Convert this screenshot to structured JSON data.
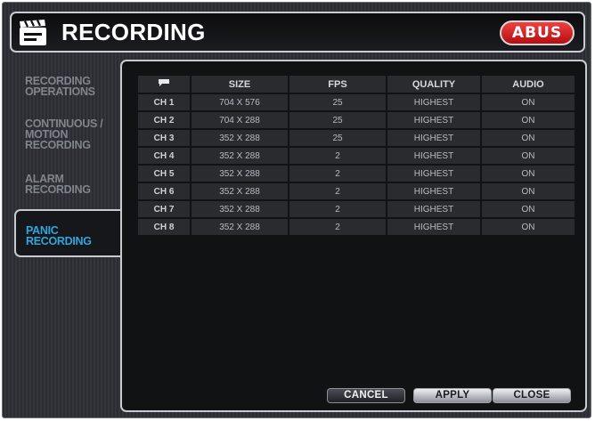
{
  "window": {
    "title": "RECORDING",
    "logo": "ABUS"
  },
  "sidebar": {
    "items": [
      {
        "label": [
          "RECORDING",
          "OPERATIONS"
        ],
        "active": false
      },
      {
        "label": [
          "CONTINUOUS /",
          "MOTION",
          "RECORDING"
        ],
        "active": false
      },
      {
        "label": [
          "ALARM",
          "RECORDING"
        ],
        "active": false
      },
      {
        "label": [
          "PANIC",
          "RECORDING"
        ],
        "active": true
      }
    ]
  },
  "table": {
    "header_icon": "flag-icon",
    "columns": [
      "SIZE",
      "FPS",
      "QUALITY",
      "AUDIO"
    ],
    "rows": [
      {
        "channel": "CH 1",
        "size": "704 X 576",
        "fps": "25",
        "quality": "HIGHEST",
        "audio": "ON"
      },
      {
        "channel": "CH 2",
        "size": "704 X 288",
        "fps": "25",
        "quality": "HIGHEST",
        "audio": "ON"
      },
      {
        "channel": "CH 3",
        "size": "352 X 288",
        "fps": "25",
        "quality": "HIGHEST",
        "audio": "ON"
      },
      {
        "channel": "CH 4",
        "size": "352 X 288",
        "fps": "2",
        "quality": "HIGHEST",
        "audio": "ON"
      },
      {
        "channel": "CH 5",
        "size": "352 X 288",
        "fps": "2",
        "quality": "HIGHEST",
        "audio": "ON"
      },
      {
        "channel": "CH 6",
        "size": "352 X 288",
        "fps": "2",
        "quality": "HIGHEST",
        "audio": "ON"
      },
      {
        "channel": "CH 7",
        "size": "352 X 288",
        "fps": "2",
        "quality": "HIGHEST",
        "audio": "ON"
      },
      {
        "channel": "CH 8",
        "size": "352 X 288",
        "fps": "2",
        "quality": "HIGHEST",
        "audio": "ON"
      }
    ]
  },
  "buttons": {
    "cancel": "CANCEL",
    "apply": "APPLY",
    "close": "CLOSE"
  },
  "colors": {
    "accent_active": "#2fa6dd",
    "logo_red": "#c8181c",
    "panel_bg": "#111214",
    "frame_stripe": "#34363c"
  }
}
